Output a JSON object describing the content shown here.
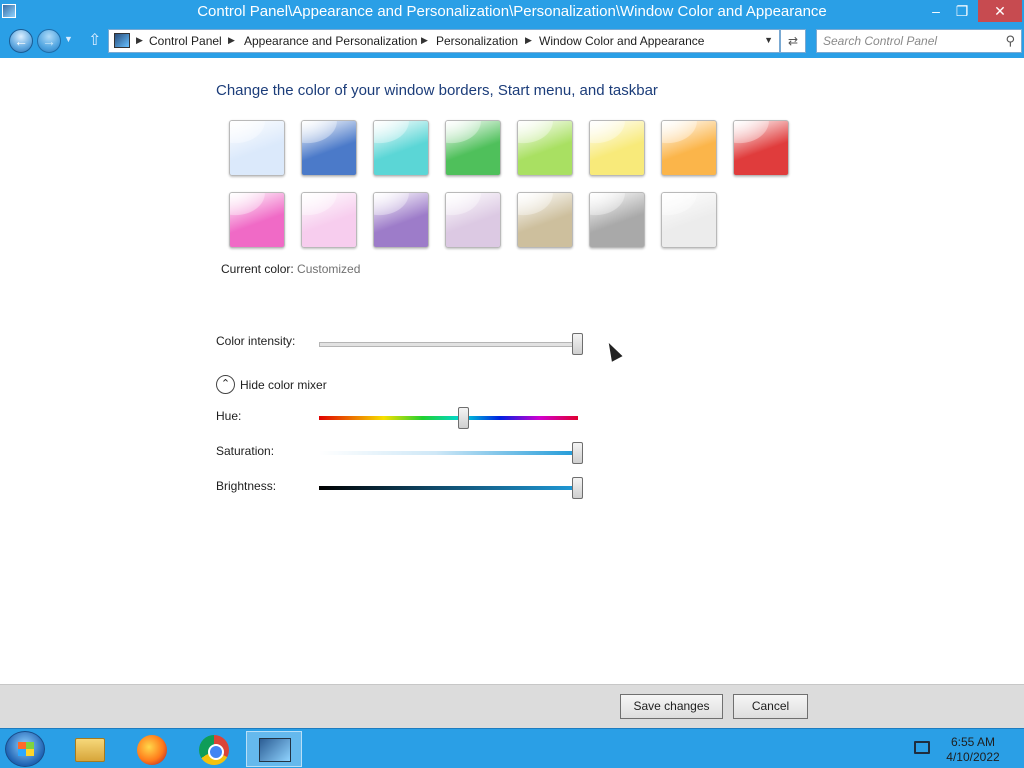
{
  "window": {
    "title": "Control Panel\\Appearance and Personalization\\Personalization\\Window Color and Appearance",
    "min_glyph": "–",
    "max_glyph": "❐",
    "close_glyph": "✕"
  },
  "nav": {
    "back_glyph": "←",
    "forward_glyph": "→",
    "breadcrumbs": [
      "Control Panel",
      "Appearance and Personalization",
      "Personalization",
      "Window Color and Appearance"
    ],
    "search_placeholder": "Search Control Panel"
  },
  "content": {
    "heading": "Change the color of your window borders, Start menu, and taskbar",
    "swatches": [
      "#dbe9fb",
      "#4b7ac9",
      "#5bd6d6",
      "#4fc05b",
      "#a9e062",
      "#f8ea7a",
      "#fbb54a",
      "#e03c3c",
      "#f06ac6",
      "#f7cdee",
      "#9d7cc9",
      "#dcc9e3",
      "#cdbf9d",
      "#a9a9a9",
      "#ececec"
    ],
    "current_color_label": "Current color:",
    "current_color_value": "Customized",
    "color_intensity_label": "Color intensity:",
    "color_intensity": 1.0,
    "mixer_toggle_label": "Hide color mixer",
    "hue_label": "Hue:",
    "hue": 0.56,
    "saturation_label": "Saturation:",
    "saturation": 1.0,
    "brightness_label": "Brightness:",
    "brightness": 1.0
  },
  "footer": {
    "save_label": "Save changes",
    "cancel_label": "Cancel"
  },
  "taskbar": {
    "time": "6:55 AM",
    "date": "4/10/2022"
  },
  "colors": {
    "chrome_blue": "#2a9fe6",
    "heading_blue": "#1c3d7a",
    "mixer_blue": "#1f9ad8"
  }
}
